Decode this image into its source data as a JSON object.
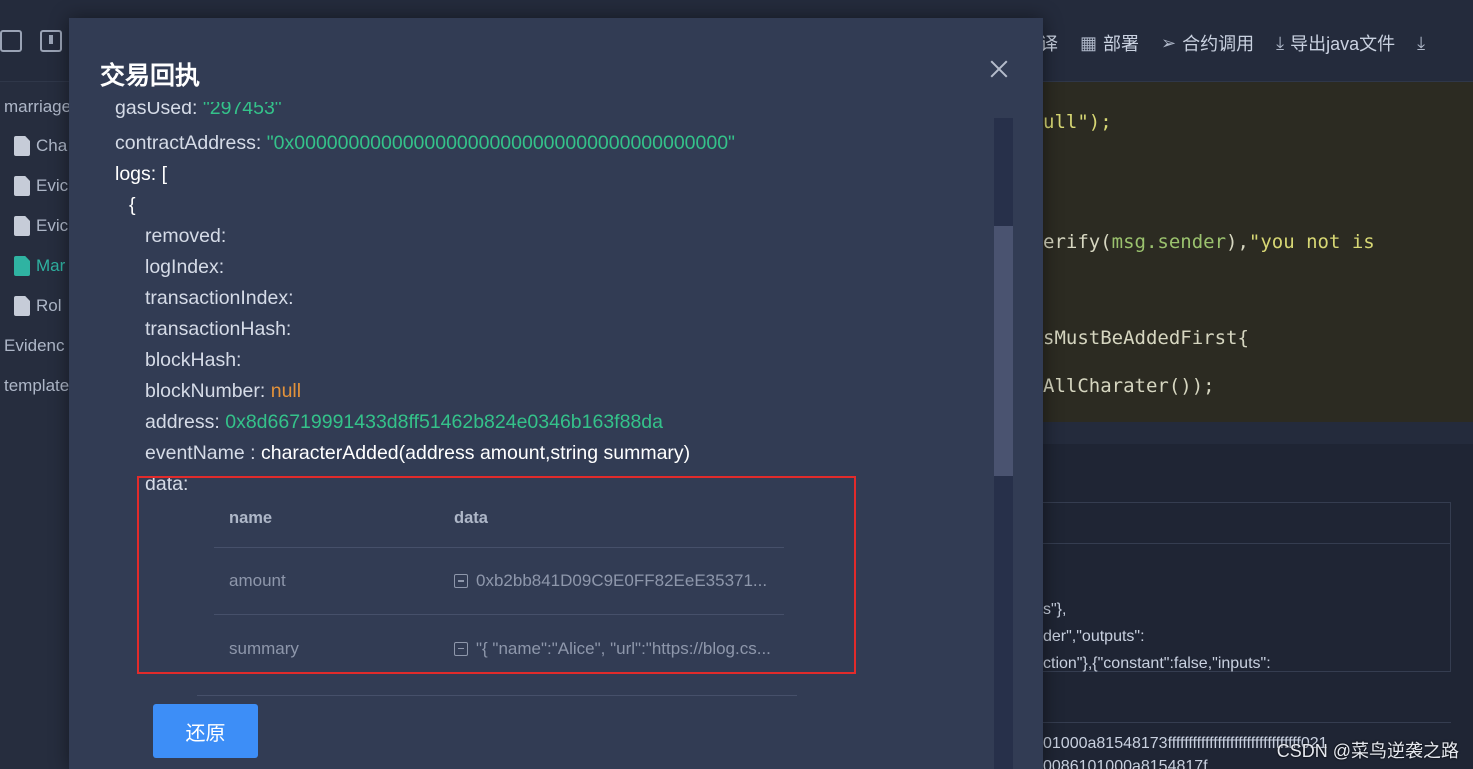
{
  "toolbar": {
    "items": [
      {
        "label": "译",
        "icon": "compile-icon"
      },
      {
        "label": "部署",
        "icon": "grid-icon"
      },
      {
        "label": "合约调用",
        "icon": "send-icon"
      },
      {
        "label": "导出java文件",
        "icon": "download-icon"
      }
    ]
  },
  "sidebar": {
    "items": [
      {
        "label": "marriage",
        "type": "folder"
      },
      {
        "label": "Cha",
        "type": "file"
      },
      {
        "label": "Evic",
        "type": "file"
      },
      {
        "label": "Evic",
        "type": "file"
      },
      {
        "label": "Mar",
        "type": "file",
        "active": true
      },
      {
        "label": "Rol",
        "type": "file"
      },
      {
        "label": "Evidenc",
        "type": "folder"
      },
      {
        "label": "template",
        "type": "folder"
      }
    ]
  },
  "editor": {
    "lines": [
      {
        "a": "ull\");",
        "b": ""
      },
      {
        "a": "erify(",
        "b": "msg.sender",
        "c": "),",
        "d": "\"you not is"
      },
      {
        "a": "sMustBeAddedFirst{"
      },
      {
        "a": "AllCharater());"
      }
    ]
  },
  "panel": {
    "line1": "s\"},",
    "line2": "der\",\"outputs\":",
    "line3": "ction\"},{\"constant\":false,\"inputs\":",
    "line4": "01000a81548173ffffffffffffffffffffffffffffffff021",
    "line5": "0086101000a8154817f"
  },
  "watermark": "CSDN @菜鸟逆袭之路",
  "modal": {
    "title": "交易回执",
    "receipt": {
      "gasUsed_label": "gasUsed: ",
      "gasUsed_value": "\"297453\"",
      "contractAddress_label": "contractAddress: ",
      "contractAddress_value": "\"0x0000000000000000000000000000000000000000\"",
      "logs_label": "logs: [",
      "open_brace": "{",
      "removed_label": "removed:",
      "logIndex_label": "logIndex:",
      "transactionIndex_label": "transactionIndex:",
      "transactionHash_label": "transactionHash:",
      "blockHash_label": "blockHash:",
      "blockNumber_label": "blockNumber: ",
      "blockNumber_value": "null",
      "address_label": "address: ",
      "address_value": "0x8d66719991433d8ff51462b824e0346b163f88da",
      "eventName_label": "eventName : ",
      "eventName_value": "characterAdded(address amount,string summary)",
      "data_label": "data:",
      "closing": "}"
    },
    "table": {
      "headers": [
        "name",
        "data"
      ],
      "rows": [
        {
          "name": "amount",
          "data": "0xb2bb841D09C9E0FF82EeE35371..."
        },
        {
          "name": "summary",
          "data": "\"{ \"name\":\"Alice\", \"url\":\"https://blog.cs..."
        }
      ]
    },
    "restore_label": "还原"
  }
}
